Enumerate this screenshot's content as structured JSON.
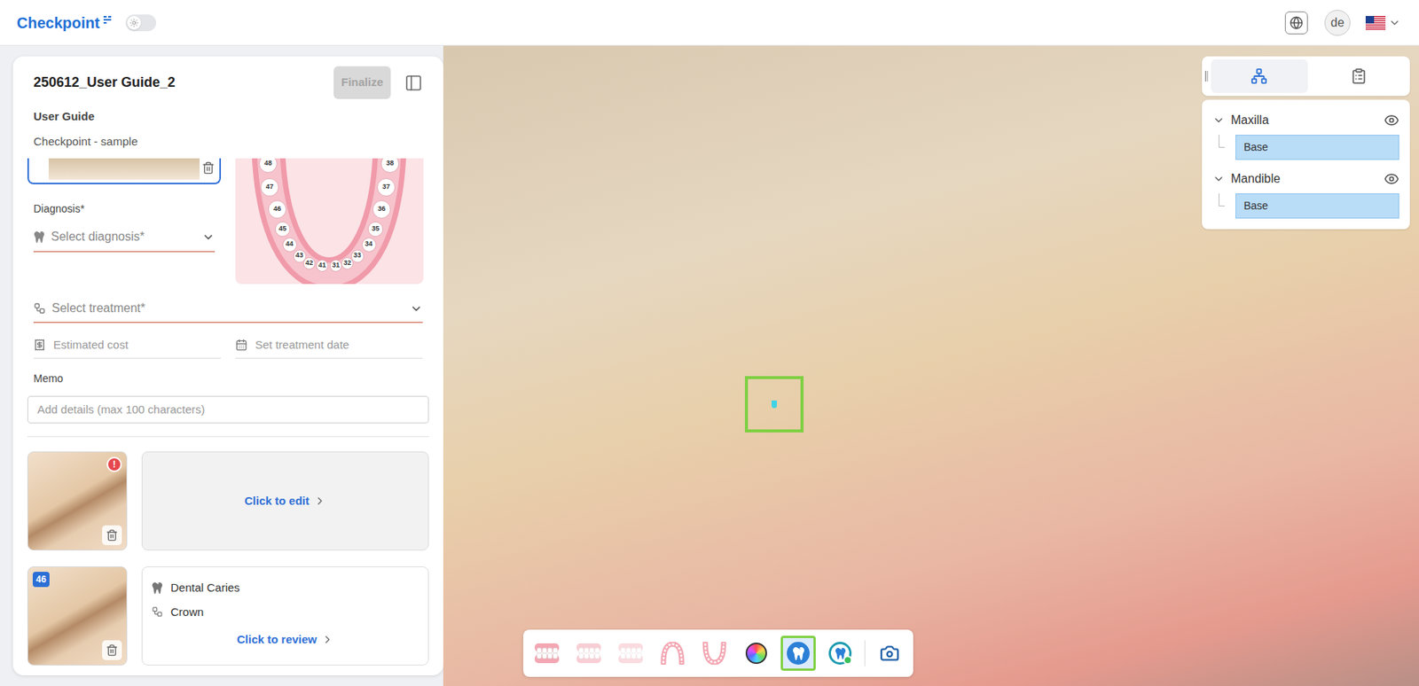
{
  "app": {
    "name": "Checkpoint",
    "dark_mode": false
  },
  "user": {
    "initials": "de"
  },
  "case": {
    "title": "250612_User Guide_2",
    "finalize": {
      "label": "Finalize",
      "disabled": true
    },
    "subtitle": "User Guide",
    "description": "Checkpoint - sample"
  },
  "image_card": {
    "selected": true
  },
  "form": {
    "diagnosis_label": "Diagnosis*",
    "diagnosis_placeholder": "Select diagnosis*",
    "treatment_placeholder": "Select treatment*",
    "cost_placeholder": "Estimated cost",
    "date_placeholder": "Set treatment date",
    "memo_label": "Memo",
    "memo_placeholder": "Add details (max 100 characters)"
  },
  "tooth_chart": {
    "teeth": [
      "48",
      "47",
      "46",
      "45",
      "44",
      "43",
      "42",
      "41",
      "31",
      "32",
      "33",
      "34",
      "35",
      "36",
      "37",
      "38"
    ]
  },
  "findings": [
    {
      "kind": "incomplete",
      "warning": "!",
      "action": "Click to edit"
    },
    {
      "kind": "complete",
      "tooth": "46",
      "diagnosis": "Dental Caries",
      "treatment": "Crown",
      "action": "Click to review"
    }
  ],
  "model_tree": {
    "tabs": [
      {
        "selected": true
      },
      {
        "selected": false
      }
    ],
    "groups": [
      {
        "name": "Maxilla",
        "expanded": true,
        "visible": true,
        "layers": [
          {
            "name": "Base",
            "selected": true
          }
        ]
      },
      {
        "name": "Mandible",
        "expanded": true,
        "visible": true,
        "layers": [
          {
            "name": "Base",
            "selected": true
          }
        ]
      }
    ]
  },
  "toolbar": {
    "tools": [
      {
        "selected": false
      },
      {
        "selected": false
      },
      {
        "selected": false
      },
      {
        "selected": false
      },
      {
        "selected": false
      },
      {
        "selected": false
      },
      {
        "selected": true
      },
      {
        "selected": false
      },
      {
        "selected": false
      }
    ]
  }
}
